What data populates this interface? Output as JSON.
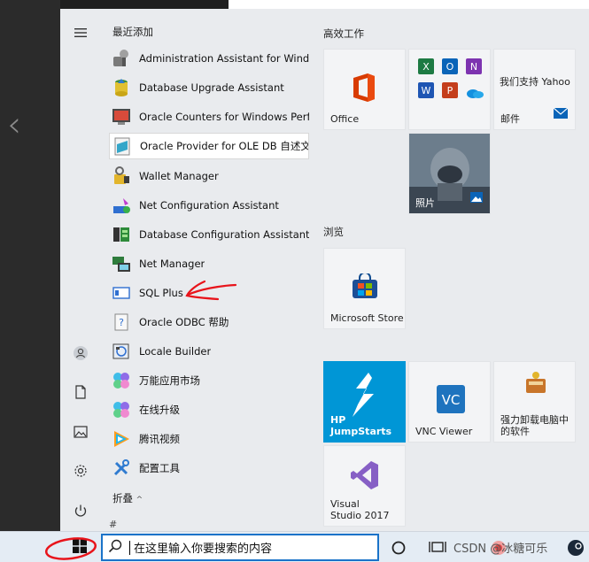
{
  "background": {
    "back_chevron": "‹"
  },
  "recent": {
    "header": "最近添加",
    "apps": [
      {
        "label": "Administration Assistant for Wind...",
        "icon": "admin-assistant-icon"
      },
      {
        "label": "Database Upgrade Assistant",
        "icon": "db-upgrade-icon"
      },
      {
        "label": "Oracle Counters for Windows Perf...",
        "icon": "oracle-counters-icon"
      },
      {
        "label": "Oracle Provider for OLE DB 自述文件",
        "icon": "readme-doc-icon"
      },
      {
        "label": "Wallet Manager",
        "icon": "wallet-icon"
      },
      {
        "label": "Net Configuration Assistant",
        "icon": "net-config-icon"
      },
      {
        "label": "Database Configuration Assistant",
        "icon": "db-config-icon"
      },
      {
        "label": "Net Manager",
        "icon": "net-manager-icon"
      },
      {
        "label": "SQL Plus",
        "icon": "sqlplus-icon"
      },
      {
        "label": "Oracle ODBC 帮助",
        "icon": "help-doc-icon"
      },
      {
        "label": "Locale Builder",
        "icon": "locale-builder-icon"
      },
      {
        "label": "万能应用市场",
        "icon": "app-market-icon"
      },
      {
        "label": "在线升级",
        "icon": "online-upgrade-icon"
      },
      {
        "label": "腾讯视频",
        "icon": "tencent-video-icon"
      },
      {
        "label": "配置工具",
        "icon": "config-tools-icon"
      }
    ],
    "fold_label": "折叠",
    "fold_chevron": "^",
    "hash_label": "#"
  },
  "tiles": {
    "group_productivity": "高效工作",
    "office_label": "Office",
    "yahoo_line": "我们支持 Yahoo",
    "mail_label": "邮件",
    "photos_label": "照片",
    "group_browse": "浏览",
    "store_label": "Microsoft Store",
    "hp_label": "HP JumpStarts",
    "vnc_label": "VNC Viewer",
    "uninstall_label": "强力卸载电脑中的软件",
    "vs_label": "Visual Studio 2017"
  },
  "taskbar": {
    "search_placeholder": "在这里输入你要搜索的内容",
    "watermark": "CSDN @冰糖可乐"
  },
  "colors": {
    "accent": "#1a73c9",
    "annotation_red": "#e8141b",
    "hp_tile": "#0096d6",
    "vs_purple": "#865fc5",
    "office_red": "#d83b01"
  }
}
